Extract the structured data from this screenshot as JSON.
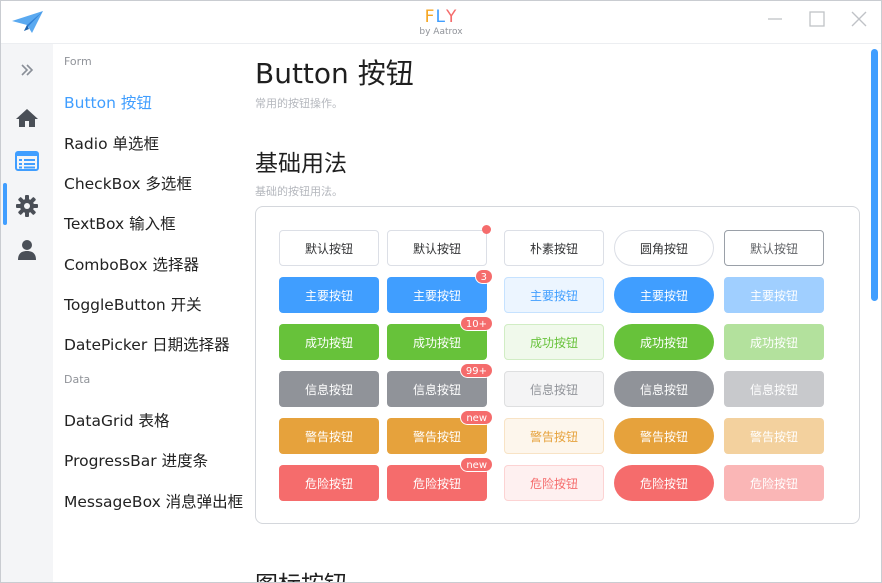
{
  "titlebar": {
    "title_letters": [
      "F",
      "L",
      "Y"
    ],
    "title_colors": [
      "#f5a623",
      "#409eff",
      "#f56c6c"
    ],
    "subtitle": "by Aatrox",
    "logo_icon": "paper-plane-icon",
    "controls": [
      "minimize-icon",
      "maximize-icon",
      "close-icon"
    ]
  },
  "rail": {
    "items": [
      {
        "icon": "double-chevron-right-icon"
      },
      {
        "icon": "home-icon"
      },
      {
        "icon": "list-icon",
        "active": true
      },
      {
        "icon": "gear-icon"
      },
      {
        "icon": "user-icon"
      }
    ],
    "accent": "#409eff"
  },
  "nav": {
    "groups": [
      {
        "label": "Form",
        "items": [
          "Button 按钮",
          "Radio 单选框",
          "CheckBox 多选框",
          "TextBox 输入框",
          "ComboBox 选择器",
          "ToggleButton 开关",
          "DatePicker 日期选择器"
        ]
      },
      {
        "label": "Data",
        "items": [
          "DataGrid 表格",
          "ProgressBar 进度条",
          "MessageBox 消息弹出框"
        ]
      }
    ],
    "active": "Button 按钮"
  },
  "main": {
    "title": "Button 按钮",
    "subtitle": "常用的按钮操作。",
    "section_title": "基础用法",
    "section_subtitle": "基础的按钮用法。",
    "next_section_title": "图标按钮"
  },
  "buttons": {
    "rows": [
      {
        "type": "default",
        "labels": [
          "默认按钮",
          "默认按钮",
          "朴素按钮",
          "圆角按钮",
          "默认按钮"
        ],
        "badge": "dot"
      },
      {
        "type": "primary",
        "labels": [
          "主要按钮",
          "主要按钮",
          "主要按钮",
          "主要按钮",
          "主要按钮"
        ],
        "badge": "3"
      },
      {
        "type": "success",
        "labels": [
          "成功按钮",
          "成功按钮",
          "成功按钮",
          "成功按钮",
          "成功按钮"
        ],
        "badge": "10+"
      },
      {
        "type": "info",
        "labels": [
          "信息按钮",
          "信息按钮",
          "信息按钮",
          "信息按钮",
          "信息按钮"
        ],
        "badge": "99+"
      },
      {
        "type": "warning",
        "labels": [
          "警告按钮",
          "警告按钮",
          "警告按钮",
          "警告按钮",
          "警告按钮"
        ],
        "badge": "new"
      },
      {
        "type": "danger",
        "labels": [
          "危险按钮",
          "危险按钮",
          "危险按钮",
          "危险按钮",
          "危险按钮"
        ],
        "badge": "new"
      }
    ],
    "colors": {
      "primary": "#409eff",
      "success": "#67c23a",
      "info": "#909399",
      "warning": "#e6a23c",
      "danger": "#f56c6c",
      "badge": "#f56c6c"
    }
  }
}
